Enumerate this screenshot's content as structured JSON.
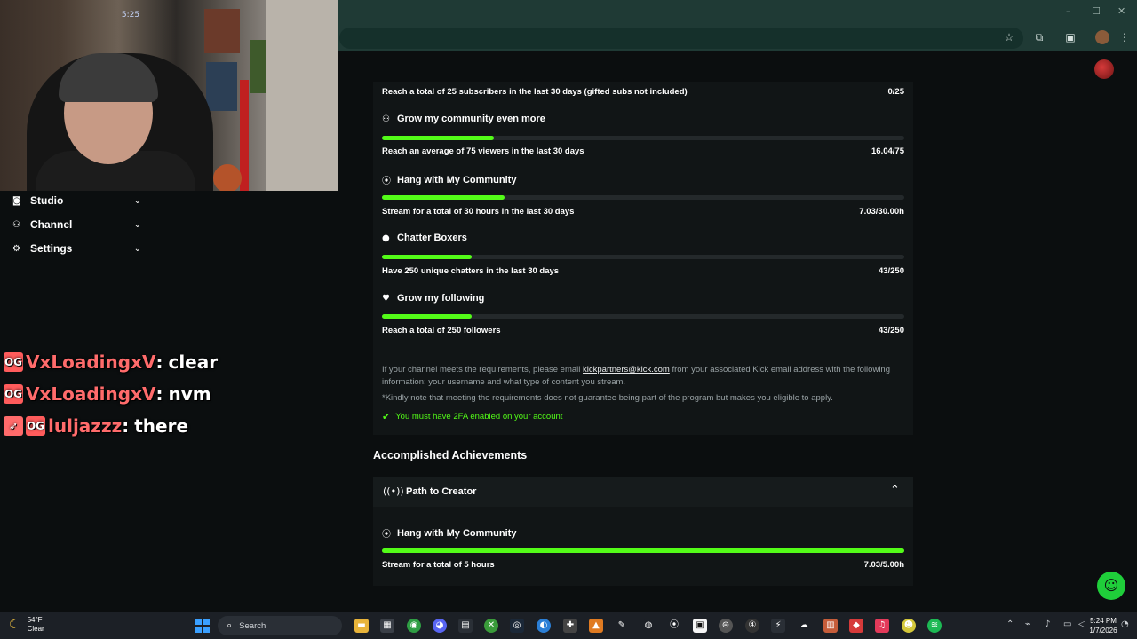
{
  "window_controls": {
    "minimize": "–",
    "maximize": "☐",
    "close": "✕"
  },
  "sidebar": {
    "items": [
      {
        "label": "Studio",
        "icon": "camera-icon"
      },
      {
        "label": "Channel",
        "icon": "people-icon"
      },
      {
        "label": "Settings",
        "icon": "gear-icon"
      }
    ]
  },
  "webcam": {
    "clock_text": "5:25"
  },
  "chat": [
    {
      "badge": "OG",
      "user": "VxLoadingxV",
      "message": "clear"
    },
    {
      "badge": "OG",
      "user": "VxLoadingxV",
      "message": "nvm"
    },
    {
      "badge": "OG",
      "user": "luljazzz",
      "message": "there"
    }
  ],
  "goals": {
    "top_item": {
      "description": "Reach a total of 25 subscribers in the last 30 days (gifted subs not included)",
      "value": "0/25"
    },
    "items": [
      {
        "title": "Grow my community even more",
        "icon": "community-icon",
        "progress": 0.214,
        "description": "Reach an average of 75 viewers in the last 30 days",
        "value": "16.04/75"
      },
      {
        "title": "Hang with My Community",
        "icon": "broadcast-icon",
        "progress": 0.234,
        "description": "Stream for a total of 30 hours in the last 30 days",
        "value": "7.03/30.00h"
      },
      {
        "title": "Chatter Boxers",
        "icon": "chat-bubble-icon",
        "progress": 0.172,
        "description": "Have 250 unique chatters in the last 30 days",
        "value": "43/250"
      },
      {
        "title": "Grow my following",
        "icon": "heart-icon",
        "progress": 0.172,
        "description": "Reach a total of 250 followers",
        "value": "43/250"
      }
    ],
    "info_prefix": "If your channel meets the requirements, please email ",
    "info_email": "kickpartners@kick.com",
    "info_suffix": " from your associated Kick email address with the following information: your username and what type of content you stream.",
    "note": "*Kindly note that meeting the requirements does not guarantee being part of the program but makes you eligible to apply.",
    "twofa": "You must have 2FA enabled on your account"
  },
  "accomplished": {
    "heading": "Accomplished Achievements",
    "section_title": "Path to Creator",
    "item": {
      "title": "Hang with My Community",
      "progress": 1.0,
      "description": "Stream for a total of 5 hours",
      "value": "7.03/5.00h"
    }
  },
  "taskbar": {
    "temp": "54°F",
    "weather": "Clear",
    "search_label": "Search",
    "time": "5:24 PM",
    "date": "1/7/2026"
  },
  "colors": {
    "accent": "#53fc18",
    "chat_user": "#ff6b6b",
    "browser_chrome": "#1f3a35"
  }
}
